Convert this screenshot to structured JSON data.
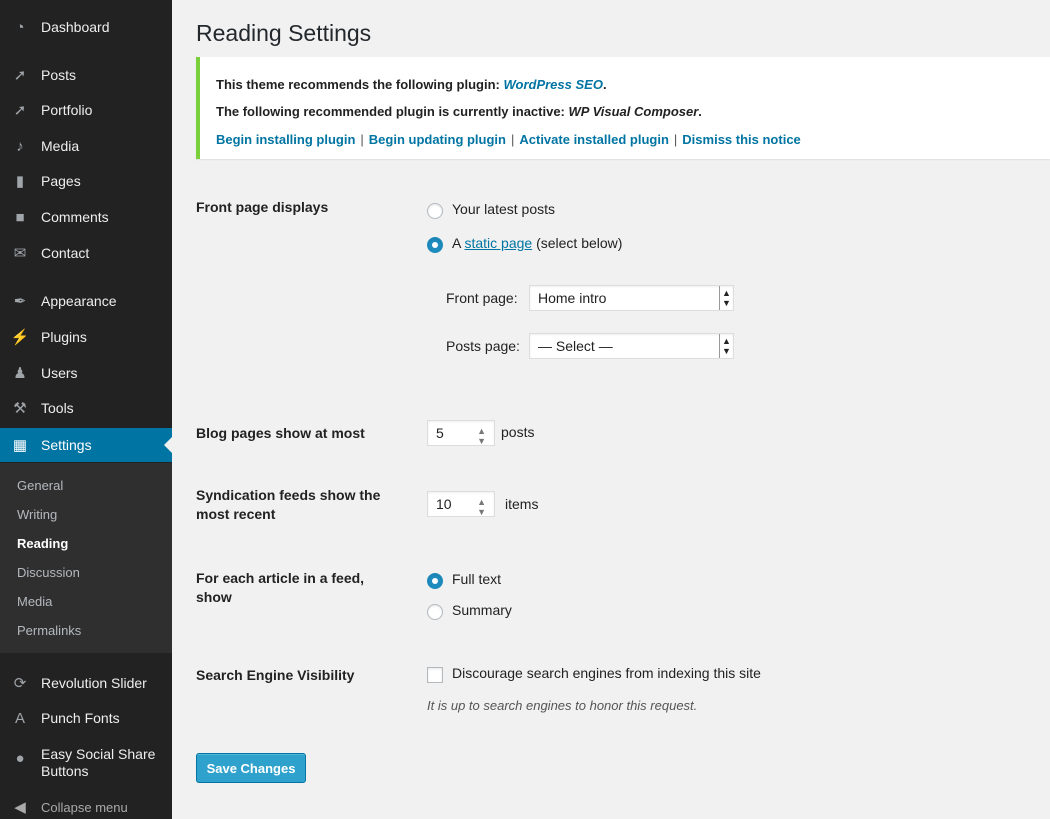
{
  "sidebar": {
    "items": [
      {
        "label": "Dashboard",
        "icon": "dashboard-icon"
      },
      {
        "label": "Posts",
        "icon": "pin-icon"
      },
      {
        "label": "Portfolio",
        "icon": "pin-icon"
      },
      {
        "label": "Media",
        "icon": "media-icon"
      },
      {
        "label": "Pages",
        "icon": "pages-icon"
      },
      {
        "label": "Comments",
        "icon": "comments-icon"
      },
      {
        "label": "Contact",
        "icon": "envelope-icon"
      },
      {
        "label": "Appearance",
        "icon": "brush-icon"
      },
      {
        "label": "Plugins",
        "icon": "plug-icon"
      },
      {
        "label": "Users",
        "icon": "user-icon"
      },
      {
        "label": "Tools",
        "icon": "wrench-icon"
      },
      {
        "label": "Settings",
        "icon": "settings-icon"
      },
      {
        "label": "Revolution Slider",
        "icon": "refresh-icon"
      },
      {
        "label": "Punch Fonts",
        "icon": "font-icon"
      },
      {
        "label": "Easy Social Share Buttons",
        "icon": "share-icon"
      },
      {
        "label": "Collapse menu",
        "icon": "collapse-icon"
      }
    ],
    "submenu": [
      "General",
      "Writing",
      "Reading",
      "Discussion",
      "Media",
      "Permalinks"
    ]
  },
  "page": {
    "title": "Reading Settings"
  },
  "notice": {
    "line1_prefix": "This theme recommends the following plugin: ",
    "line1_plugin": "WordPress SEO",
    "line1_suffix": ".",
    "line2_prefix": "The following recommended plugin is currently inactive: ",
    "line2_plugin": "WP Visual Composer",
    "line2_suffix": ".",
    "links": [
      "Begin installing plugin",
      "Begin updating plugin",
      "Activate installed plugin",
      "Dismiss this notice"
    ],
    "separator": "|"
  },
  "front_page": {
    "label": "Front page displays",
    "option_latest": "Your latest posts",
    "option_static_prefix": "A ",
    "option_static_link": "static page",
    "option_static_suffix": " (select below)",
    "selected": "static",
    "front_page_label": "Front page:",
    "front_page_value": "Home intro",
    "posts_page_label": "Posts page:",
    "posts_page_value": "— Select —"
  },
  "blog_pages": {
    "label": "Blog pages show at most",
    "value": "5",
    "unit": "posts"
  },
  "syndication": {
    "label": "Syndication feeds show the most recent",
    "value": "10",
    "unit": "items"
  },
  "feed_article": {
    "label": "For each article in a feed, show",
    "option_full": "Full text",
    "option_summary": "Summary",
    "selected": "full"
  },
  "search_visibility": {
    "label": "Search Engine Visibility",
    "checkbox_label": "Discourage search engines from indexing this site",
    "checked": false,
    "description": "It is up to search engines to honor this request."
  },
  "save_button": "Save Changes",
  "colors": {
    "sidebar_bg": "#222222",
    "sidebar_current": "#0074a2",
    "accent": "#2ea2cc",
    "notice_border": "#7ad03a",
    "link": "#0074a2"
  }
}
